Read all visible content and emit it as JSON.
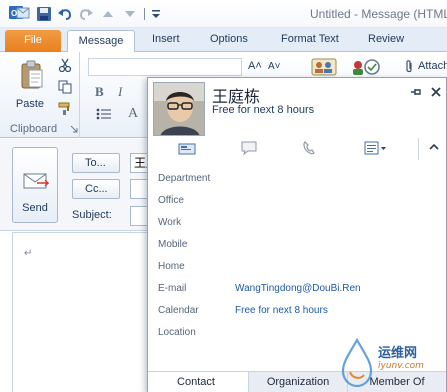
{
  "titlebar": {
    "window_title": "Untitled - Message (HTML)"
  },
  "ribbon": {
    "tabs": [
      {
        "label": "File"
      },
      {
        "label": "Message"
      },
      {
        "label": "Insert"
      },
      {
        "label": "Options"
      },
      {
        "label": "Format Text"
      },
      {
        "label": "Review"
      }
    ],
    "clipboard": {
      "paste_label": "Paste",
      "group_label": "Clipboard"
    },
    "attach_label": "Attach"
  },
  "compose": {
    "send_label": "Send",
    "to_label": "To...",
    "cc_label": "Cc...",
    "subject_label": "Subject:",
    "to_value": "王庭栋",
    "paragraph_mark": "↵"
  },
  "contact_card": {
    "name": "王庭栋",
    "status": "Free for next 8 hours",
    "fields": [
      {
        "label": "Department",
        "value": ""
      },
      {
        "label": "Office",
        "value": ""
      },
      {
        "label": "Work",
        "value": ""
      },
      {
        "label": "Mobile",
        "value": ""
      },
      {
        "label": "Home",
        "value": ""
      },
      {
        "label": "E-mail",
        "value": "WangTingdong@DouBi.Ren"
      },
      {
        "label": "Calendar",
        "value": "Free for next 8 hours"
      },
      {
        "label": "Location",
        "value": ""
      }
    ],
    "tabs": [
      {
        "label": "Contact"
      },
      {
        "label": "Organization"
      },
      {
        "label": "Member Of"
      }
    ]
  },
  "watermark": {
    "text_cn": "运维网",
    "url": "iyunv.com"
  },
  "colors": {
    "file_tab": "#e97f1e",
    "accent_text": "#1e395b",
    "link": "#1f5aa8"
  }
}
